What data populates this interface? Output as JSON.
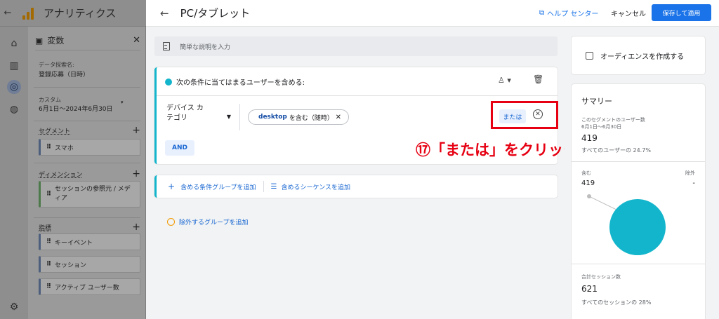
{
  "app": {
    "title": "アナリティクス"
  },
  "variables_panel": {
    "title": "変数",
    "data_explorer_label": "データ探索名:",
    "data_explorer_value": "登録応募（日時）",
    "date_label": "カスタム",
    "date_value": "6月1日～2024年6月30日",
    "segments_label": "セグメント",
    "segments": [
      "スマホ"
    ],
    "dimensions_label": "ディメンション",
    "dimensions": [
      "セッションの参照元 / メディア"
    ],
    "metrics_label": "指標",
    "metrics": [
      "キーイベント",
      "セッション",
      "アクティブ ユーザー数"
    ]
  },
  "header": {
    "page_title": "PC/タブレット",
    "help_label": "ヘルプ センター",
    "cancel_label": "キャンセル",
    "save_label": "保存して適用"
  },
  "builder": {
    "description_placeholder": "簡単な説明を入力",
    "include_header": "次の条件に当てはまるユーザーを含める:",
    "dimension_line1": "デバイス カ",
    "dimension_line2": "テゴリ",
    "filter_value": "desktop",
    "filter_suffix": "を含む（随時）",
    "or_label": "または",
    "and_label": "AND",
    "add_condition_group": "含める条件グループを追加",
    "add_sequence": "含めるシーケンスを追加",
    "add_exclude_group": "除外するグループを追加"
  },
  "annotation": {
    "text": "⑰「または」をクリック"
  },
  "summary": {
    "create_audience": "オーディエンスを作成する",
    "title": "サマリー",
    "users_label": "このセグメントのユーザー数",
    "users_date": "6月1日～6月30日",
    "users_value": "419",
    "users_share": "すべてのユーザーの 24.7%",
    "include_label": "含む",
    "exclude_label": "除外",
    "include_value": "419",
    "exclude_value": "-",
    "sessions_label": "合計セッション数",
    "sessions_value": "621",
    "sessions_share": "すべてのセッションの 28%"
  },
  "colors": {
    "accent": "#1a73e8",
    "segment": "#12b5cb",
    "annotation": "#e60012"
  }
}
